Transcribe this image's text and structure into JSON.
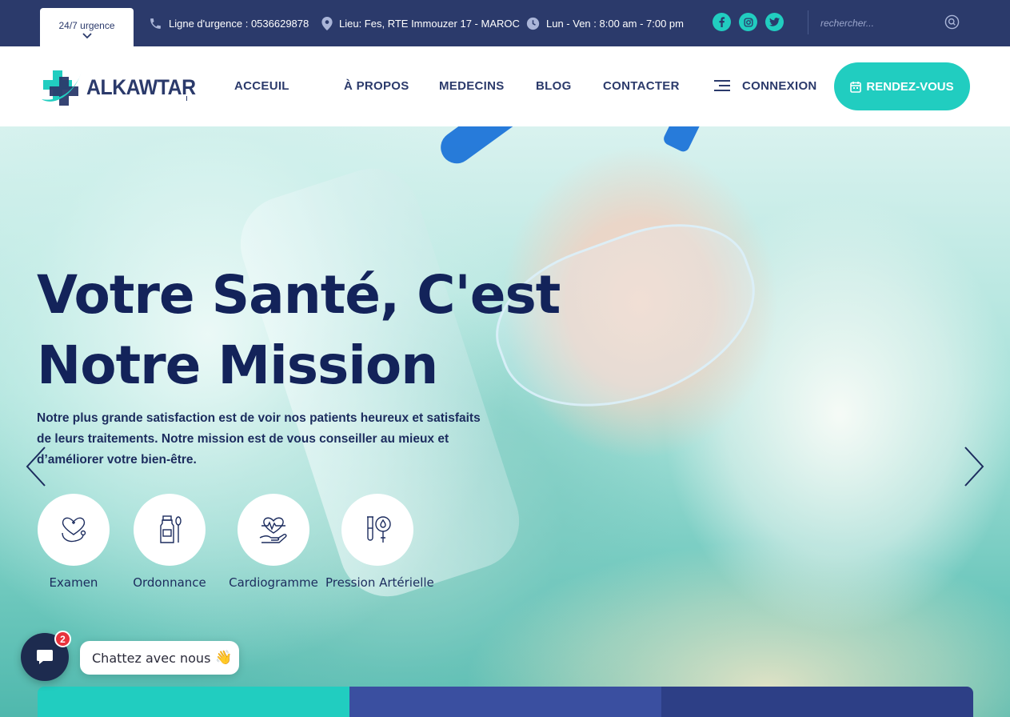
{
  "topbar": {
    "urgence_label": "24/7 urgence",
    "phone": "Ligne d'urgence : 0536629878",
    "location": "Lieu: Fes, RTE Immouzer 17 - MAROC",
    "hours": "Lun - Ven : 8:00 am - 7:00 pm",
    "socials": [
      "facebook-icon",
      "instagram-icon",
      "twitter-icon"
    ],
    "search_placeholder": "rechercher..."
  },
  "header": {
    "logo_text": "ALKAWTAR",
    "nav": {
      "accueil": "ACCEUIL",
      "apropos": "À PROPOS",
      "medecins": "MEDECINS",
      "blog": "BLOG",
      "contact": "CONTACTER",
      "connexion": "CONNEXION"
    },
    "cta": "RENDEZ-VOUS"
  },
  "hero": {
    "title_line1": "Votre Santé, C'est",
    "title_line2": "Notre Mission",
    "text": "Notre plus grande satisfaction est de voir nos patients heureux et satisfaits de leurs traitements. Notre mission est de vous conseiller au mieux et d’améliorer votre bien-être.",
    "services": [
      {
        "label": "Examen",
        "icon": "heart-stethoscope-icon"
      },
      {
        "label": "Ordonnance",
        "icon": "medicine-bottle-icon"
      },
      {
        "label": "Cardiogramme",
        "icon": "heart-hand-icon"
      },
      {
        "label": "Pression Artérielle",
        "icon": "test-tube-drop-icon"
      }
    ]
  },
  "chat": {
    "badge": "2",
    "text": "Chattez avec nous",
    "emoji": "👋"
  },
  "colors": {
    "navy": "#2b3a6b",
    "teal": "#21cdc0",
    "title": "#13235a"
  }
}
